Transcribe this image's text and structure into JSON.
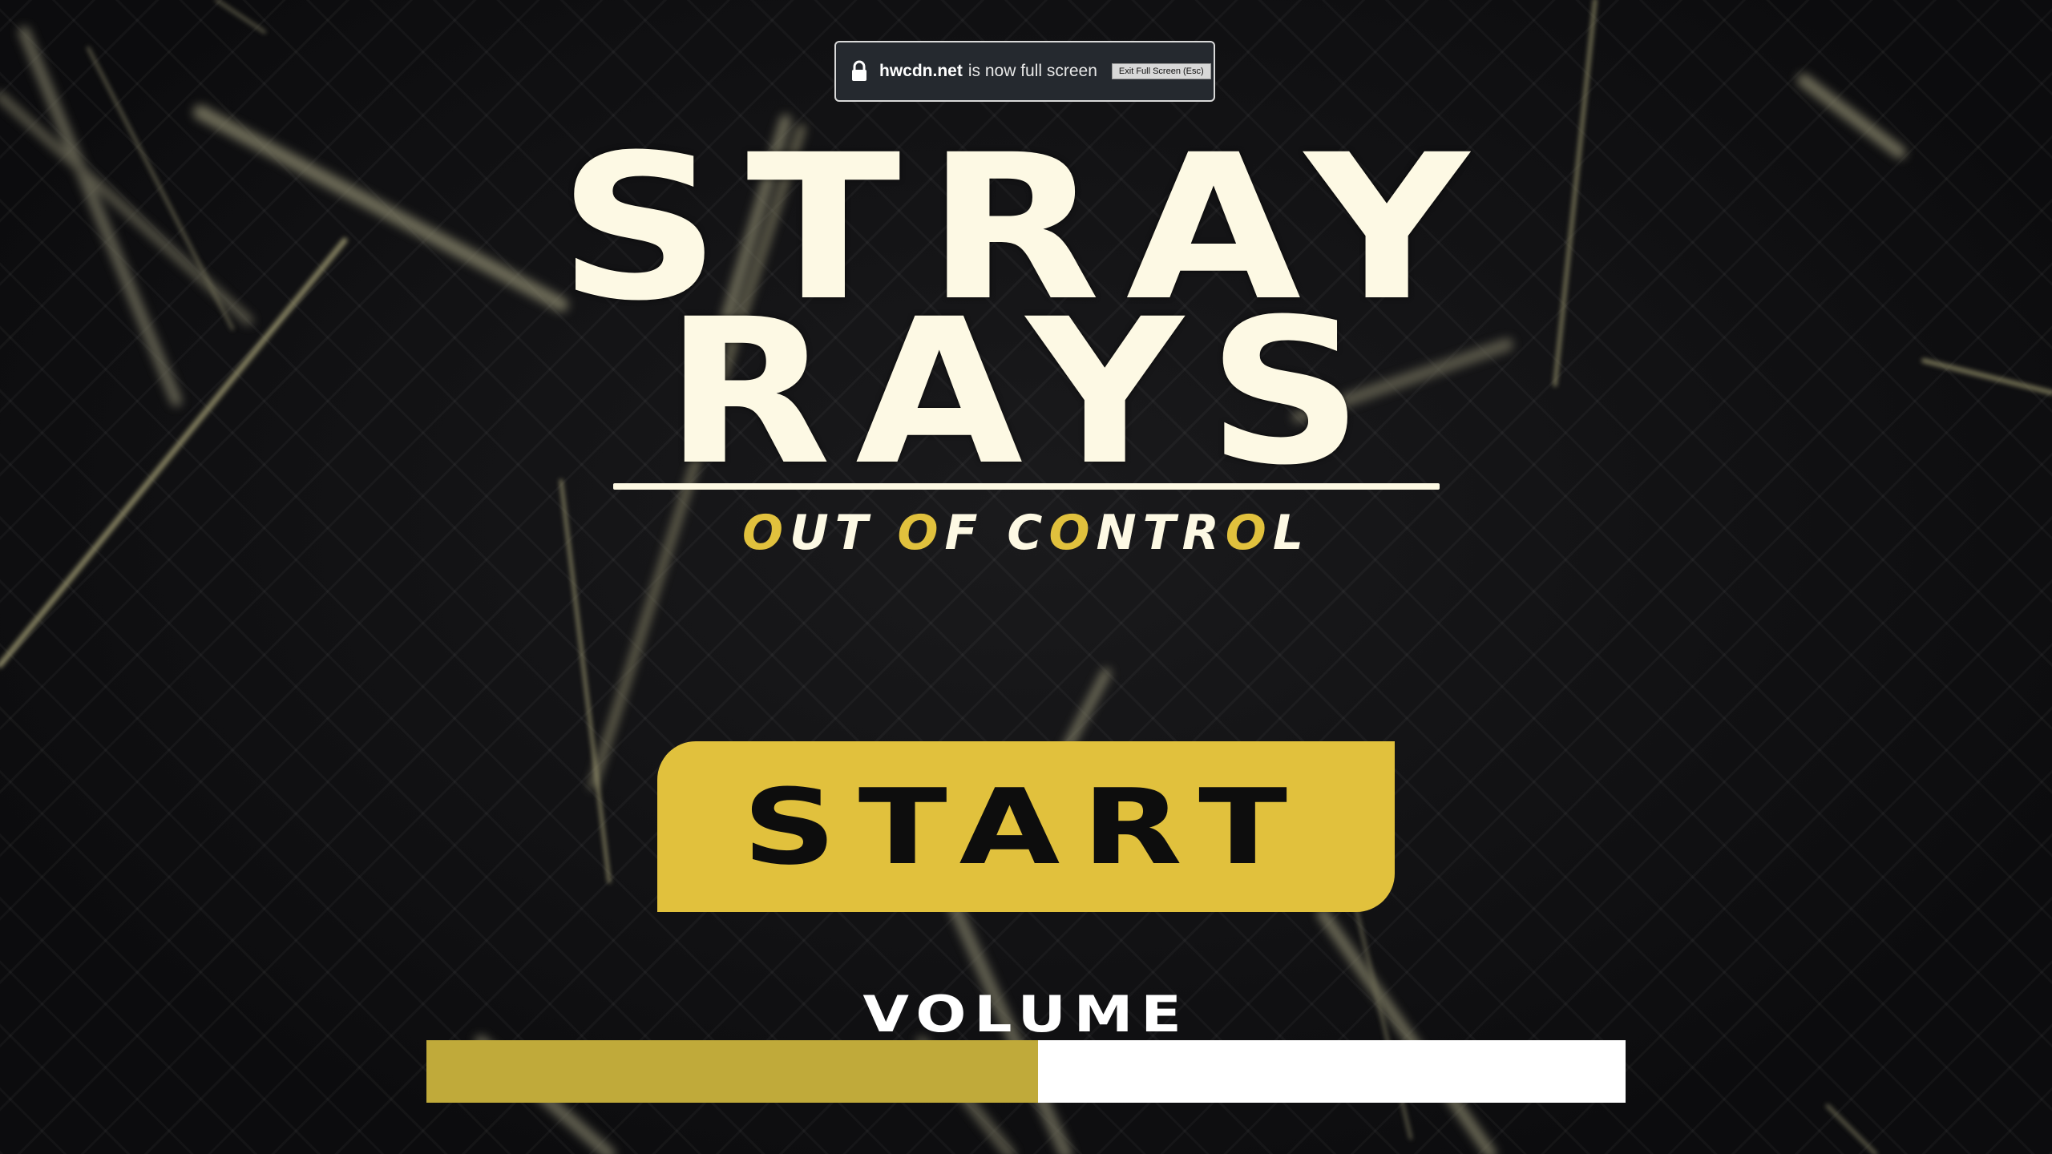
{
  "fullscreen_notice": {
    "domain": "hwcdn.net",
    "message": "is now full screen",
    "exit_label": "Exit Full Screen (Esc)",
    "icon": "lock-icon"
  },
  "game": {
    "title_line1": "STRAY",
    "title_line2": "RAYS",
    "subtitle_parts": [
      {
        "text": "O",
        "highlight": true
      },
      {
        "text": "UT ",
        "highlight": false
      },
      {
        "text": "O",
        "highlight": true
      },
      {
        "text": "F C",
        "highlight": false
      },
      {
        "text": "O",
        "highlight": true
      },
      {
        "text": "NTR",
        "highlight": false
      },
      {
        "text": "O",
        "highlight": true
      },
      {
        "text": "L",
        "highlight": false
      }
    ],
    "start_label": "START",
    "volume_label": "VOLUME",
    "volume_level": 0.51
  },
  "colors": {
    "title": "#fdf9e4",
    "accent": "#e1c13d",
    "volume_fill": "#c0aa3a",
    "background": "#0f0f11"
  }
}
